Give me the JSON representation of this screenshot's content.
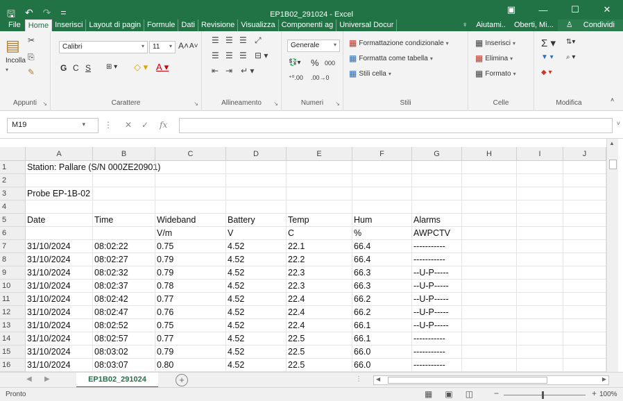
{
  "window": {
    "title": "EP1B02_291024 - Excel",
    "controls": {
      "ribbon_display": "▣",
      "minimize": "—",
      "maximize": "☐",
      "close": "✕"
    },
    "quick_access": {
      "save": "🖫",
      "undo": "↶",
      "redo": "↷",
      "customize": "="
    }
  },
  "menu": {
    "file": "File",
    "tabs": [
      "Home",
      "Inserisci",
      "Layout di pagin",
      "Formule",
      "Dati",
      "Revisione",
      "Visualizza",
      "Componenti ag",
      "Universal Docur"
    ],
    "active_index": 0,
    "tell_me": "Aiutami..",
    "user": "Oberti, Mi...",
    "share": "Condividi"
  },
  "ribbon": {
    "clipboard": {
      "paste": "Incolla",
      "label": "Appunti"
    },
    "font": {
      "name": "Calibri",
      "size": "11",
      "bold": "G",
      "italic": "C",
      "underline": "S",
      "label": "Carattere"
    },
    "alignment": {
      "label": "Allineamento"
    },
    "number": {
      "format": "Generale",
      "percent": "%",
      "thousands": "000",
      "label": "Numeri"
    },
    "styles": {
      "conditional": "Formattazione condizionale",
      "table": "Formatta come tabella",
      "cell": "Stili cella",
      "label": "Stili"
    },
    "cells": {
      "insert": "Inserisci",
      "delete": "Elimina",
      "format": "Formato",
      "label": "Celle"
    },
    "editing": {
      "label": "Modifica"
    }
  },
  "formula_bar": {
    "name_box": "M19",
    "fx": "fx",
    "value": ""
  },
  "columns": [
    "A",
    "B",
    "C",
    "D",
    "E",
    "F",
    "G",
    "H",
    "I",
    "J"
  ],
  "rows": [
    {
      "n": "1",
      "cells": [
        "Station: Pallare (S/N 000ZE20901)",
        "",
        "",
        "",
        "",
        "",
        "",
        "",
        "",
        ""
      ]
    },
    {
      "n": "2",
      "cells": [
        "",
        "",
        "",
        "",
        "",
        "",
        "",
        "",
        "",
        ""
      ]
    },
    {
      "n": "3",
      "cells": [
        "Probe EP-1B-02",
        "",
        "",
        "",
        "",
        "",
        "",
        "",
        "",
        ""
      ]
    },
    {
      "n": "4",
      "cells": [
        "",
        "",
        "",
        "",
        "",
        "",
        "",
        "",
        "",
        ""
      ]
    },
    {
      "n": "5",
      "cells": [
        "Date",
        "Time",
        "Wideband",
        "Battery",
        "Temp",
        "Hum",
        "Alarms",
        "",
        "",
        ""
      ]
    },
    {
      "n": "6",
      "cells": [
        "",
        "",
        "V/m",
        "V",
        "C",
        "%",
        "AWPCTV",
        "",
        "",
        ""
      ]
    },
    {
      "n": "7",
      "cells": [
        "31/10/2024",
        "08:02:22",
        "0.75",
        "4.52",
        "22.1",
        "66.4",
        "-----------",
        "",
        "",
        ""
      ]
    },
    {
      "n": "8",
      "cells": [
        "31/10/2024",
        "08:02:27",
        "0.79",
        "4.52",
        "22.2",
        "66.4",
        "-----------",
        "",
        "",
        ""
      ]
    },
    {
      "n": "9",
      "cells": [
        "31/10/2024",
        "08:02:32",
        "0.79",
        "4.52",
        "22.3",
        "66.3",
        "--U-P-----",
        "",
        "",
        ""
      ]
    },
    {
      "n": "10",
      "cells": [
        "31/10/2024",
        "08:02:37",
        "0.78",
        "4.52",
        "22.3",
        "66.3",
        "--U-P-----",
        "",
        "",
        ""
      ]
    },
    {
      "n": "11",
      "cells": [
        "31/10/2024",
        "08:02:42",
        "0.77",
        "4.52",
        "22.4",
        "66.2",
        "--U-P-----",
        "",
        "",
        ""
      ]
    },
    {
      "n": "12",
      "cells": [
        "31/10/2024",
        "08:02:47",
        "0.76",
        "4.52",
        "22.4",
        "66.2",
        "--U-P-----",
        "",
        "",
        ""
      ]
    },
    {
      "n": "13",
      "cells": [
        "31/10/2024",
        "08:02:52",
        "0.75",
        "4.52",
        "22.4",
        "66.1",
        "--U-P-----",
        "",
        "",
        ""
      ]
    },
    {
      "n": "14",
      "cells": [
        "31/10/2024",
        "08:02:57",
        "0.77",
        "4.52",
        "22.5",
        "66.1",
        "-----------",
        "",
        "",
        ""
      ]
    },
    {
      "n": "15",
      "cells": [
        "31/10/2024",
        "08:03:02",
        "0.79",
        "4.52",
        "22.5",
        "66.0",
        "-----------",
        "",
        "",
        ""
      ]
    },
    {
      "n": "16",
      "cells": [
        "31/10/2024",
        "08:03:07",
        "0.80",
        "4.52",
        "22.5",
        "66.0",
        "-----------",
        "",
        "",
        ""
      ]
    }
  ],
  "sheet_tab": "EP1B02_291024",
  "add_sheet": "+",
  "status": {
    "text": "Pronto",
    "zoom": "100%"
  },
  "colors": {
    "accent": "#217346",
    "ribbon_bg": "#f3f3f3",
    "header_bg": "#efefef"
  }
}
